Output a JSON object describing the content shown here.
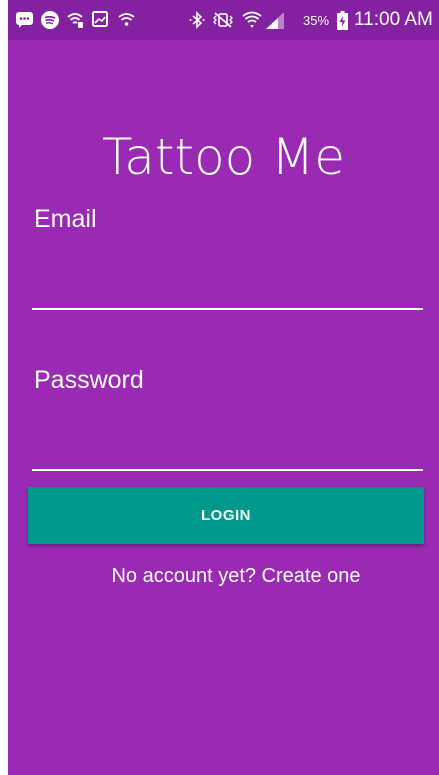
{
  "status_bar": {
    "icons": [
      "messenger-icon",
      "spotify-icon",
      "wifi-call-icon",
      "gallery-icon",
      "wifi-icon",
      "bluetooth-icon",
      "vibrate-icon",
      "wifi-signal-icon",
      "cell-signal-icon",
      "battery-charging-icon"
    ],
    "battery_percent": "35%",
    "time": "11:00 AM"
  },
  "app": {
    "title": "Tattoo Me"
  },
  "form": {
    "email_label": "Email",
    "email_value": "",
    "password_label": "Password",
    "password_value": "",
    "login_label": "LOGIN",
    "signup_text": "No account yet? Create one"
  },
  "colors": {
    "background": "#9a29b3",
    "status_bar": "#8321a0",
    "button": "#00988a",
    "text": "#ffffff"
  }
}
